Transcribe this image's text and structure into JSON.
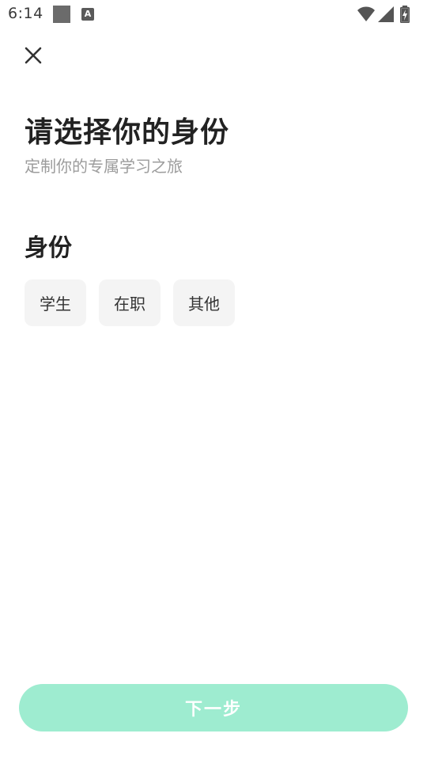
{
  "status_bar": {
    "time": "6:14",
    "icons": [
      "notification-square-icon",
      "keyboard-a-icon",
      "wifi-icon",
      "cellular-signal-icon",
      "battery-charging-icon"
    ]
  },
  "header": {
    "close_icon": "close-icon"
  },
  "main": {
    "title": "请选择你的身份",
    "subtitle": "定制你的专属学习之旅",
    "section_label": "身份",
    "options": [
      {
        "label": "学生"
      },
      {
        "label": "在职"
      },
      {
        "label": "其他"
      }
    ]
  },
  "footer": {
    "next_label": "下一步"
  },
  "colors": {
    "accent": "#9eecd0",
    "chip_bg": "#f4f4f4",
    "subtitle": "#9c9c9c",
    "title": "#222222"
  }
}
